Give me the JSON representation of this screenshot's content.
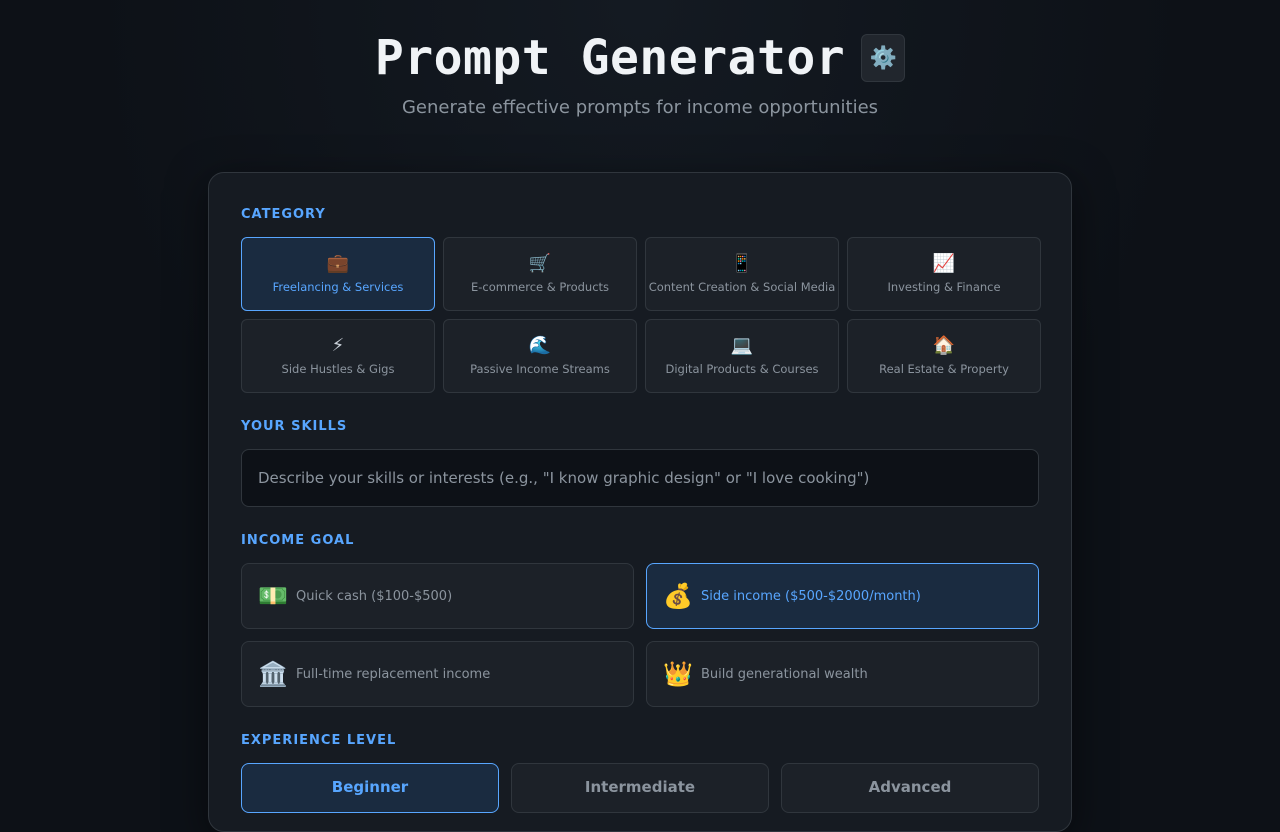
{
  "header": {
    "title": "Prompt Generator",
    "settings_icon": "gear-icon",
    "settings_glyph": "⚙️",
    "subtitle": "Generate effective prompts for income opportunities"
  },
  "category": {
    "label": "CATEGORY",
    "selected": "Freelancing & Services",
    "items": [
      {
        "icon": "briefcase-icon",
        "glyph": "💼",
        "label": "Freelancing & Services"
      },
      {
        "icon": "shopping-cart-icon",
        "glyph": "🛒",
        "label": "E-commerce & Products"
      },
      {
        "icon": "mobile-phone-icon",
        "glyph": "📱",
        "label": "Content Creation & Social Media"
      },
      {
        "icon": "chart-increasing-icon",
        "glyph": "📈",
        "label": "Investing & Finance"
      },
      {
        "icon": "lightning-icon",
        "glyph": "⚡",
        "label": "Side Hustles & Gigs"
      },
      {
        "icon": "wave-icon",
        "glyph": "🌊",
        "label": "Passive Income Streams"
      },
      {
        "icon": "laptop-icon",
        "glyph": "💻",
        "label": "Digital Products & Courses"
      },
      {
        "icon": "house-icon",
        "glyph": "🏠",
        "label": "Real Estate & Property"
      }
    ]
  },
  "skills": {
    "label": "YOUR SKILLS",
    "value": "",
    "placeholder": "Describe your skills or interests (e.g., \"I know graphic design\" or \"I love cooking\")"
  },
  "income_goal": {
    "label": "INCOME GOAL",
    "selected": "Side income ($500-$2000/month)",
    "items": [
      {
        "icon": "dollar-banknote-icon",
        "glyph": "💵",
        "label": "Quick cash ($100-$500)"
      },
      {
        "icon": "money-bag-icon",
        "glyph": "💰",
        "label": "Side income ($500-$2000/month)"
      },
      {
        "icon": "bank-icon",
        "glyph": "🏛️",
        "label": "Full-time replacement income"
      },
      {
        "icon": "crown-icon",
        "glyph": "👑",
        "label": "Build generational wealth"
      }
    ]
  },
  "experience": {
    "label": "EXPERIENCE LEVEL",
    "selected": "Beginner",
    "items": [
      {
        "label": "Beginner"
      },
      {
        "label": "Intermediate"
      },
      {
        "label": "Advanced"
      }
    ]
  },
  "colors": {
    "background": "#0d1117",
    "card": "#161b22",
    "accent": "#58a6ff",
    "muted_text": "#8b949e"
  }
}
